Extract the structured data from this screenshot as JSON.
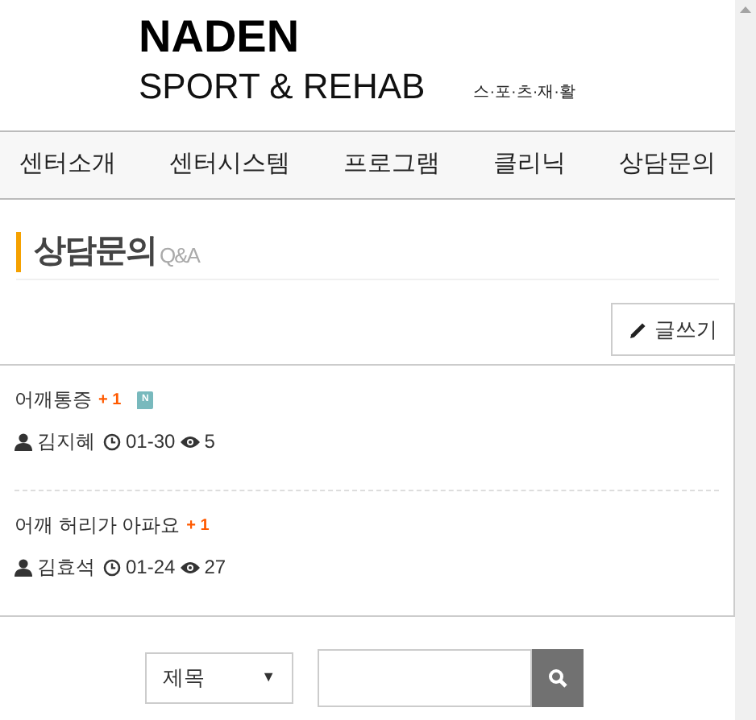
{
  "logo": {
    "name": "NADEN",
    "subtitle": "SPORT & REHAB",
    "tagline": "스·포·츠·재·활"
  },
  "nav": [
    {
      "label": "센터소개"
    },
    {
      "label": "센터시스템"
    },
    {
      "label": "프로그램"
    },
    {
      "label": "클리닉"
    },
    {
      "label": "상담문의"
    }
  ],
  "page_title": {
    "title": "상담문의",
    "subtitle": "Q&A"
  },
  "write_button": "글쓰기",
  "posts": [
    {
      "title": "어깨통증",
      "comment_count": "+ 1",
      "is_new": true,
      "new_badge": "N",
      "author": "김지혜",
      "date": "01-30",
      "views": "5"
    },
    {
      "title": "어깨 허리가 아파요",
      "comment_count": "+ 1",
      "is_new": false,
      "author": "김효석",
      "date": "01-24",
      "views": "27"
    }
  ],
  "search": {
    "field": "제목",
    "arrow": "▼"
  }
}
